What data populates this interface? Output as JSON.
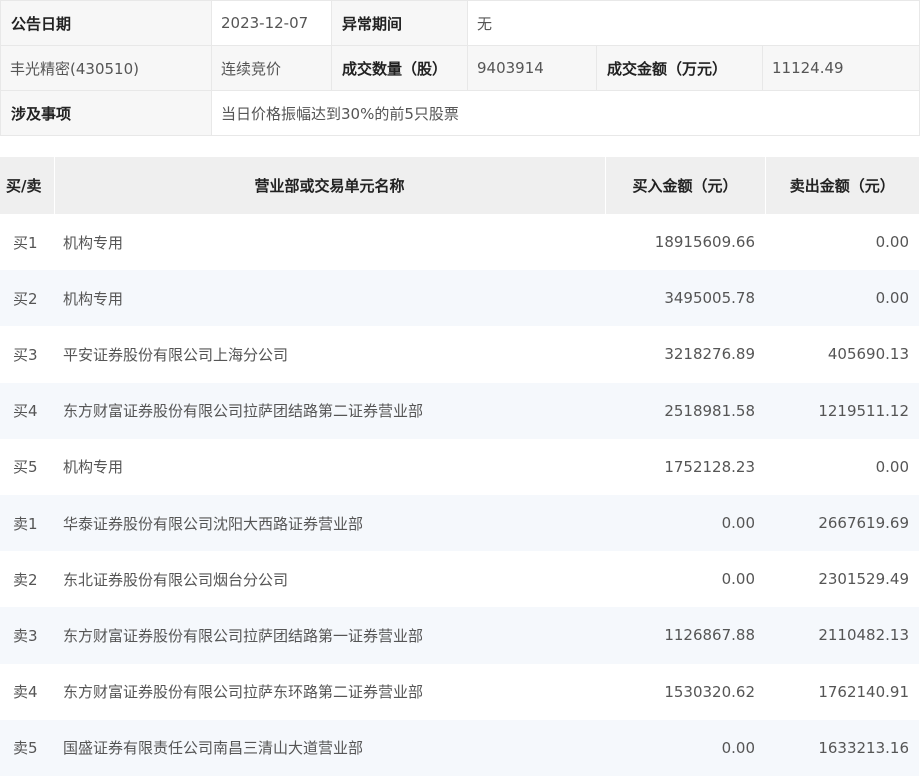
{
  "info": {
    "announce_date_label": "公告日期",
    "announce_date_value": "2023-12-07",
    "abnormal_period_label": "异常期间",
    "abnormal_period_value": "无",
    "stock_name": "丰光精密(430510)",
    "trade_method": "连续竞价",
    "volume_label": "成交数量（股）",
    "volume_value": "9403914",
    "amount_label": "成交金额（万元）",
    "amount_value": "11124.49",
    "matter_label": "涉及事项",
    "matter_value": "当日价格振幅达到30%的前5只股票"
  },
  "table": {
    "headers": {
      "side": "买/卖",
      "name": "营业部或交易单元名称",
      "buy": "买入金额（元）",
      "sell": "卖出金额（元）"
    },
    "rows": [
      {
        "side": "买1",
        "name": "机构专用",
        "buy": "18915609.66",
        "sell": "0.00"
      },
      {
        "side": "买2",
        "name": "机构专用",
        "buy": "3495005.78",
        "sell": "0.00"
      },
      {
        "side": "买3",
        "name": "平安证券股份有限公司上海分公司",
        "buy": "3218276.89",
        "sell": "405690.13"
      },
      {
        "side": "买4",
        "name": "东方财富证券股份有限公司拉萨团结路第二证券营业部",
        "buy": "2518981.58",
        "sell": "1219511.12"
      },
      {
        "side": "买5",
        "name": "机构专用",
        "buy": "1752128.23",
        "sell": "0.00"
      },
      {
        "side": "卖1",
        "name": "华泰证券股份有限公司沈阳大西路证券营业部",
        "buy": "0.00",
        "sell": "2667619.69"
      },
      {
        "side": "卖2",
        "name": "东北证券股份有限公司烟台分公司",
        "buy": "0.00",
        "sell": "2301529.49"
      },
      {
        "side": "卖3",
        "name": "东方财富证券股份有限公司拉萨团结路第一证券营业部",
        "buy": "1126867.88",
        "sell": "2110482.13"
      },
      {
        "side": "卖4",
        "name": "东方财富证券股份有限公司拉萨东环路第二证券营业部",
        "buy": "1530320.62",
        "sell": "1762140.91"
      },
      {
        "side": "卖5",
        "name": "国盛证券有限责任公司南昌三清山大道营业部",
        "buy": "0.00",
        "sell": "1633213.16"
      }
    ]
  }
}
